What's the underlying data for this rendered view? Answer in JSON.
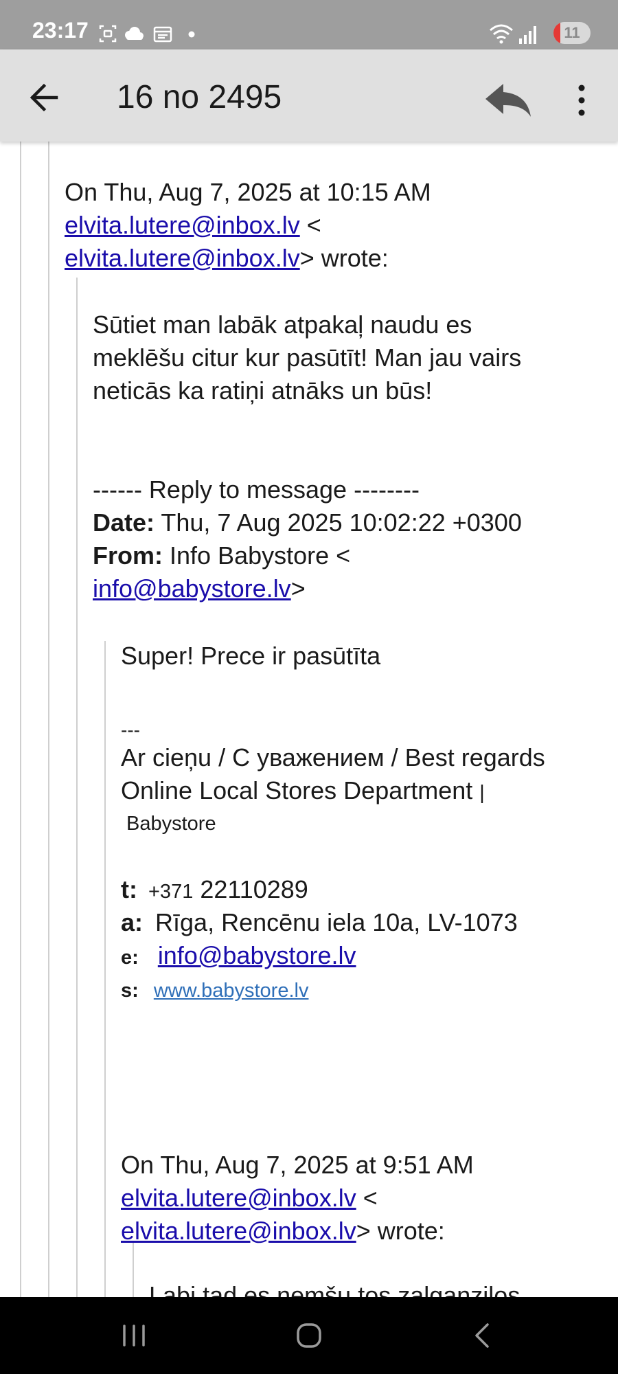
{
  "status_bar": {
    "time": "23:17",
    "left_icons": [
      "screenshot-icon",
      "cloud-icon",
      "calendar-icon",
      "dot-icon"
    ],
    "right_icons": [
      "wifi-icon",
      "signal-icon"
    ],
    "battery_level": "11",
    "battery_low_color": "#e53935"
  },
  "app_bar": {
    "title": "16 no 2495",
    "back_icon": "arrow-left-icon",
    "reply_icon": "reply-icon",
    "more_icon": "more-vertical-icon"
  },
  "message": {
    "quote1_header": {
      "line1": "On Thu, Aug 7, 2025 at 10:15 AM",
      "email1": "elvita.lutere@inbox.lv",
      "sep1": " <",
      "email2": "elvita.lutere@inbox.lv",
      "tail": "> wrote:"
    },
    "body1": [
      "Sūtiet man labāk atpakaļ naudu es",
      "meklēšu citur kur pasūtīt! Man jau vairs",
      "neticās ka ratiņi atnāks un būs!"
    ],
    "reply_header": {
      "divider": "------ Reply to message --------",
      "date_label": "Date:",
      "date_value": " Thu, 7 Aug 2025 10:02:22 +0300",
      "from_label": "From:",
      "from_value": " Info Babystore <",
      "from_email": "info@babystore.lv",
      "from_tail": ">"
    },
    "body2": "Super! Prece ir pasūtīta",
    "signature": {
      "dashes": "---",
      "regards": "Ar cieņu / С уважением / Best regards",
      "department": "Online Local Stores Department",
      "separator": "|",
      "company": "Babystore",
      "phone_label": "t:",
      "phone_prefix": "+371",
      "phone_number": " 22110289",
      "address_label": "a:",
      "address": "Rīga, Rencēnu iela 10a, LV-1073",
      "email_label": "e:",
      "email": "info@babystore.lv",
      "site_label": "s:",
      "site": "www.babystore.lv"
    },
    "quote2_header": {
      "line1": "On Thu, Aug 7, 2025 at 9:51 AM",
      "email1": "elvita.lutere@inbox.lv",
      "sep1": " <",
      "email2": "elvita.lutere@inbox.lv",
      "tail": "> wrote:"
    },
    "body3_partial": "Labi tad es nemšu tos zalganzilos"
  },
  "nav_bar": {
    "recents_icon": "recents-icon",
    "home_icon": "home-icon",
    "back_icon": "nav-back-icon"
  }
}
